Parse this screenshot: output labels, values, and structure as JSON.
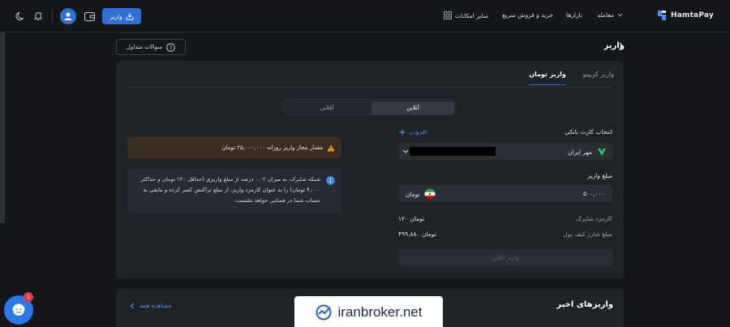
{
  "header": {
    "brand": "HamtaPay",
    "nav": {
      "trade": "معامله",
      "markets": "بازارها",
      "quick_buy_sell": "خرید و فروش سریع",
      "other_features": "سایر امکانات"
    },
    "deposit_button": "واریز"
  },
  "page": {
    "title": "واریز",
    "faq_button": "سوالات متداول"
  },
  "tabs": {
    "toman": "واریز تومان",
    "crypto": "واریز کریپتو"
  },
  "mode": {
    "online": "آنلاین",
    "offline": "آفلاین"
  },
  "form": {
    "bank_card_label": "انتخاب کارت بانکی",
    "add_label": "افزودن",
    "bank_name": "مهر ایران",
    "amount_label": "مبلغ واریز",
    "amount_value": "۵۰۰,۰۰۰",
    "currency": "تومان",
    "fee_label": "کارمزد شاپرک",
    "fee_value": "۱۲۰ تومان",
    "wallet_charge_label": "مبلغ شارژ کیف پول",
    "wallet_charge_value": "۴۹۹,۸۸۰ تومان",
    "submit": "واریز آنلاین"
  },
  "alerts": {
    "daily_limit": "مقدار مجاز واریز روزانه ۲۵,۰۰۰,۰۰۰ تومان",
    "fee_info": "شبکه شاپرک، به میزان ۰.۰۲ درصد از مبلغ واریزی (حداقل ۱۲۰ تومان و حداکثر ۴,۰۰۰ تومان) را به عنوان کارمزد واریز، از مبلغ تراکنش کسر کرده و مابقی به حساب شما در همتاپی خواهد نشست."
  },
  "recent": {
    "title": "واریزهای اخیر",
    "view_all": "مشاهده همه"
  },
  "watermark": "iranbroker.net",
  "support": {
    "badge": "1"
  },
  "colors": {
    "accent": "#2f6fd6",
    "background": "#14161a",
    "card": "#1f2227",
    "warning": "#f5a524",
    "info": "#3d8ef0",
    "success": "#2ecc71"
  }
}
